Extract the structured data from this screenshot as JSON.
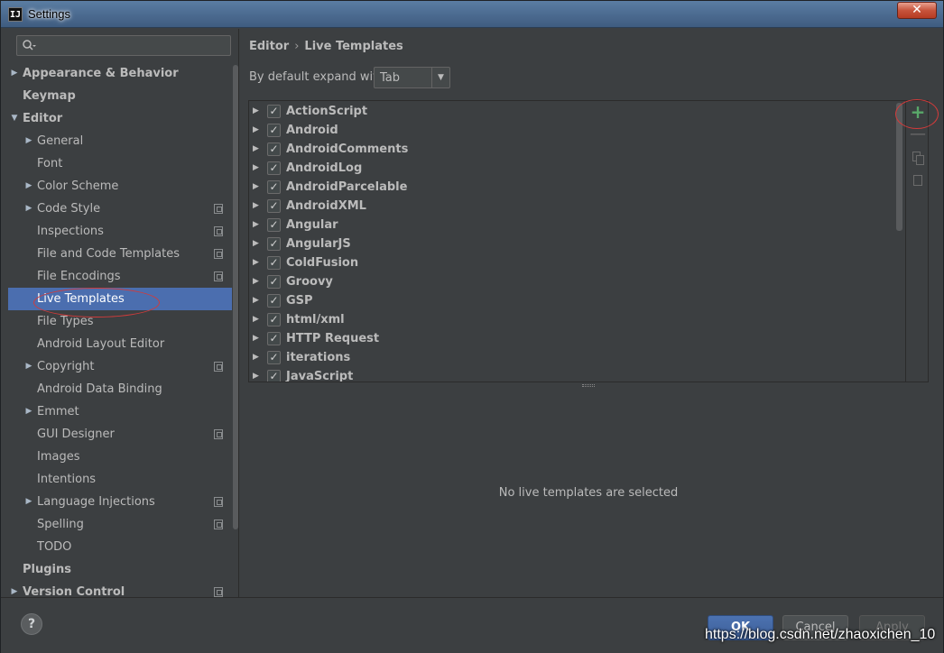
{
  "window": {
    "title": "Settings",
    "close_label": "✕",
    "app_icon_text": "IJ"
  },
  "sidebar": {
    "search": {
      "placeholder": ""
    },
    "items": [
      {
        "label": "Appearance & Behavior",
        "level": 0,
        "bold": true,
        "arrow": "collapsed",
        "project_icon": false
      },
      {
        "label": "Keymap",
        "level": 0,
        "bold": true,
        "arrow": "none",
        "project_icon": false
      },
      {
        "label": "Editor",
        "level": 0,
        "bold": true,
        "arrow": "expanded",
        "project_icon": false
      },
      {
        "label": "General",
        "level": 1,
        "bold": false,
        "arrow": "collapsed",
        "project_icon": false
      },
      {
        "label": "Font",
        "level": 1,
        "bold": false,
        "arrow": "none",
        "project_icon": false
      },
      {
        "label": "Color Scheme",
        "level": 1,
        "bold": false,
        "arrow": "collapsed",
        "project_icon": false
      },
      {
        "label": "Code Style",
        "level": 1,
        "bold": false,
        "arrow": "collapsed",
        "project_icon": true
      },
      {
        "label": "Inspections",
        "level": 1,
        "bold": false,
        "arrow": "none",
        "project_icon": true
      },
      {
        "label": "File and Code Templates",
        "level": 1,
        "bold": false,
        "arrow": "none",
        "project_icon": true
      },
      {
        "label": "File Encodings",
        "level": 1,
        "bold": false,
        "arrow": "none",
        "project_icon": true
      },
      {
        "label": "Live Templates",
        "level": 1,
        "bold": false,
        "arrow": "none",
        "project_icon": false,
        "selected": true
      },
      {
        "label": "File Types",
        "level": 1,
        "bold": false,
        "arrow": "none",
        "project_icon": false
      },
      {
        "label": "Android Layout Editor",
        "level": 1,
        "bold": false,
        "arrow": "none",
        "project_icon": false
      },
      {
        "label": "Copyright",
        "level": 1,
        "bold": false,
        "arrow": "collapsed",
        "project_icon": true
      },
      {
        "label": "Android Data Binding",
        "level": 1,
        "bold": false,
        "arrow": "none",
        "project_icon": false
      },
      {
        "label": "Emmet",
        "level": 1,
        "bold": false,
        "arrow": "collapsed",
        "project_icon": false
      },
      {
        "label": "GUI Designer",
        "level": 1,
        "bold": false,
        "arrow": "none",
        "project_icon": true
      },
      {
        "label": "Images",
        "level": 1,
        "bold": false,
        "arrow": "none",
        "project_icon": false
      },
      {
        "label": "Intentions",
        "level": 1,
        "bold": false,
        "arrow": "none",
        "project_icon": false
      },
      {
        "label": "Language Injections",
        "level": 1,
        "bold": false,
        "arrow": "collapsed",
        "project_icon": true
      },
      {
        "label": "Spelling",
        "level": 1,
        "bold": false,
        "arrow": "none",
        "project_icon": true
      },
      {
        "label": "TODO",
        "level": 1,
        "bold": false,
        "arrow": "none",
        "project_icon": false
      },
      {
        "label": "Plugins",
        "level": 0,
        "bold": true,
        "arrow": "none",
        "project_icon": false
      },
      {
        "label": "Version Control",
        "level": 0,
        "bold": true,
        "arrow": "collapsed",
        "project_icon": true
      }
    ]
  },
  "main": {
    "breadcrumb": {
      "parent": "Editor",
      "separator": "›",
      "current": "Live Templates"
    },
    "expand_label": "By default expand with",
    "expand_value": "Tab",
    "templates": [
      {
        "name": "ActionScript",
        "checked": true
      },
      {
        "name": "Android",
        "checked": true
      },
      {
        "name": "AndroidComments",
        "checked": true
      },
      {
        "name": "AndroidLog",
        "checked": true
      },
      {
        "name": "AndroidParcelable",
        "checked": true
      },
      {
        "name": "AndroidXML",
        "checked": true
      },
      {
        "name": "Angular",
        "checked": true
      },
      {
        "name": "AngularJS",
        "checked": true
      },
      {
        "name": "ColdFusion",
        "checked": true
      },
      {
        "name": "Groovy",
        "checked": true
      },
      {
        "name": "GSP",
        "checked": true
      },
      {
        "name": "html/xml",
        "checked": true
      },
      {
        "name": "HTTP Request",
        "checked": true
      },
      {
        "name": "iterations",
        "checked": true
      },
      {
        "name": "JavaScript",
        "checked": true
      }
    ],
    "toolbar": {
      "add": "+",
      "remove": "—"
    },
    "empty_message": "No live templates are selected"
  },
  "footer": {
    "help": "?",
    "ok": "OK",
    "cancel": "Cancel",
    "apply": "Apply"
  },
  "watermark": "https://blog.csdn.net/zhaoxichen_10",
  "colors": {
    "background": "#3c3f41",
    "selection": "#4b6eaf",
    "text": "#bbbbbb",
    "add_icon": "#59a869",
    "annotation": "#d13b3b"
  }
}
